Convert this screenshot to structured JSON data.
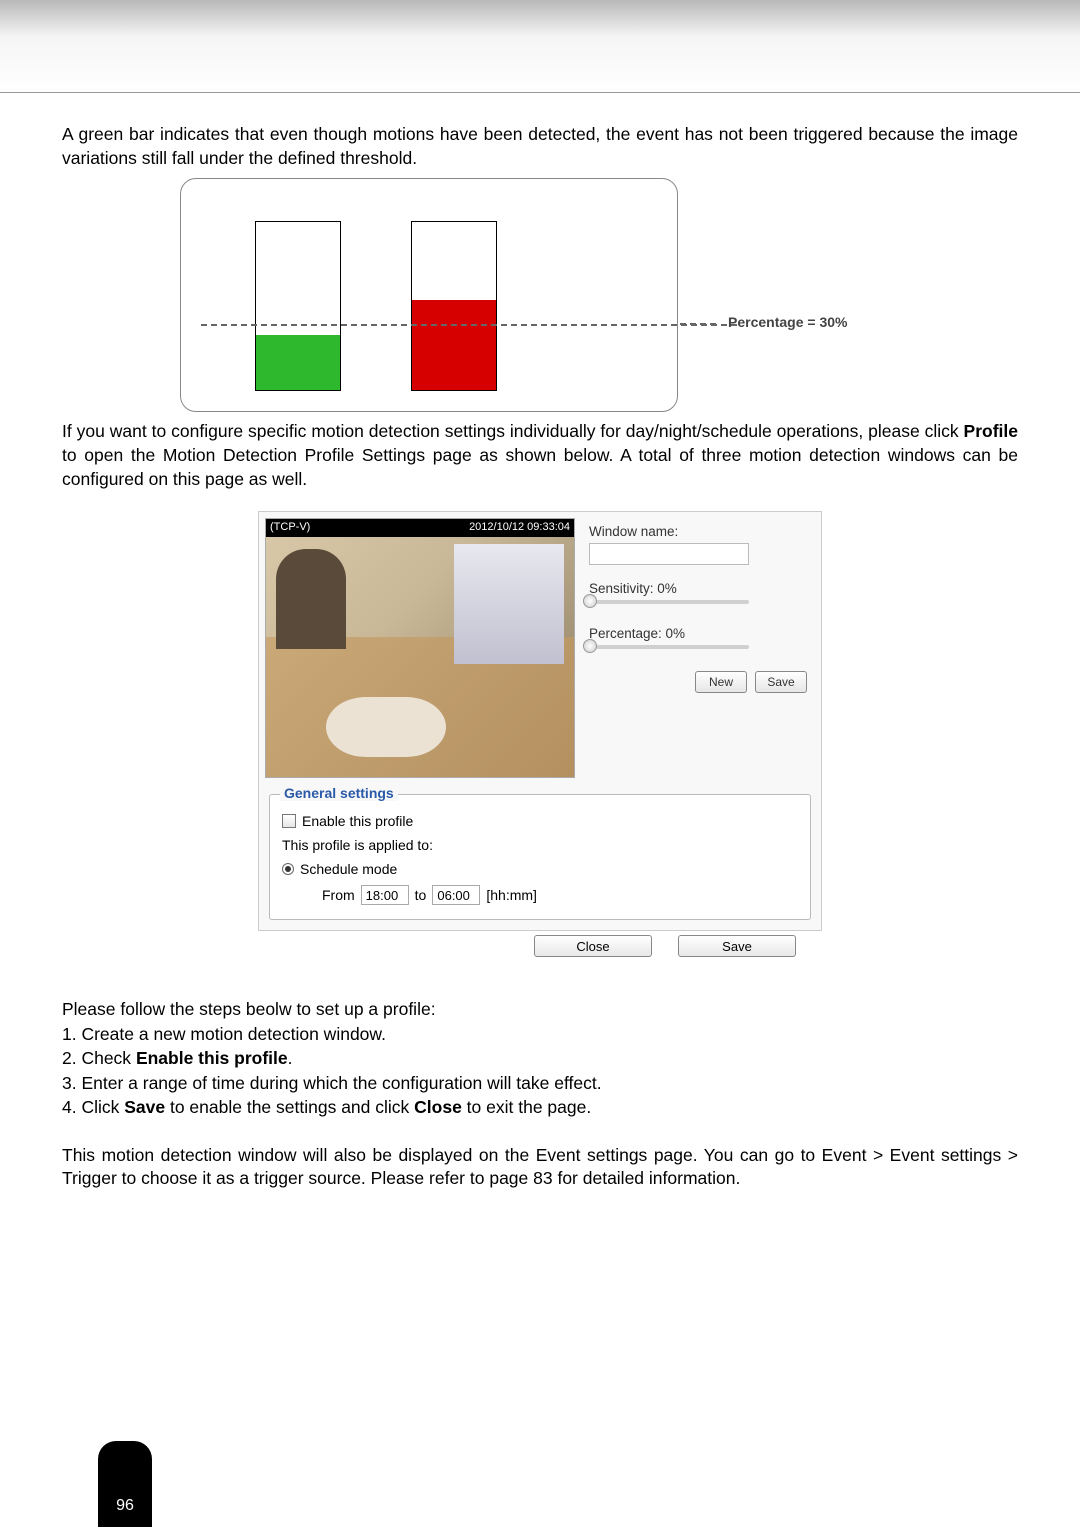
{
  "para1": "A green bar indicates that even though motions have been detected, the event has not been triggered because the image variations still fall under the defined threshold.",
  "chart_data": {
    "type": "bar",
    "categories": [
      "green-bar",
      "red-bar"
    ],
    "values": [
      18,
      52
    ],
    "threshold_label": "Percentage = 30%",
    "threshold_value": 30,
    "ylabel": "",
    "ylim": [
      0,
      100
    ]
  },
  "para2_pre": "If you want to configure specific motion detection settings individually for day/night/schedule operations, please click ",
  "para2_bold": "Profile",
  "para2_post": " to open the Motion Detection Profile Settings page as shown below. A total of three motion detection windows can be configured on this page as well.",
  "preview": {
    "title_left": "(TCP-V)",
    "title_right": "2012/10/12  09:33:04"
  },
  "right": {
    "window_name_label": "Window name:",
    "sensitivity_label": "Sensitivity: 0%",
    "percentage_label": "Percentage: 0%",
    "new_btn": "New",
    "save_btn": "Save"
  },
  "general": {
    "legend": "General settings",
    "enable": "Enable this profile",
    "applied": "This profile is applied to:",
    "schedule": "Schedule mode",
    "from": "From",
    "from_val": "18:00",
    "to": "to",
    "to_val": "06:00",
    "hhmm": "[hh:mm]"
  },
  "close_btn": "Close",
  "save_btn": "Save",
  "steps": {
    "intro": "Please follow the steps beolw to set up a profile:",
    "s1": "1. Create a new motion detection window.",
    "s2a": "2. Check ",
    "s2b": "Enable this profile",
    "s2c": ".",
    "s3": "3. Enter a range of time during which the configuration will take effect.",
    "s4a": "4. Click ",
    "s4b": "Save",
    "s4c": " to enable the settings and click ",
    "s4d": "Close",
    "s4e": " to exit the page."
  },
  "footer": "This motion detection window will also be displayed on the Event settings page. You can go to Event > Event settings > Trigger to choose it as a trigger source. Please refer to page 83 for detailed information.",
  "page_number": "96"
}
